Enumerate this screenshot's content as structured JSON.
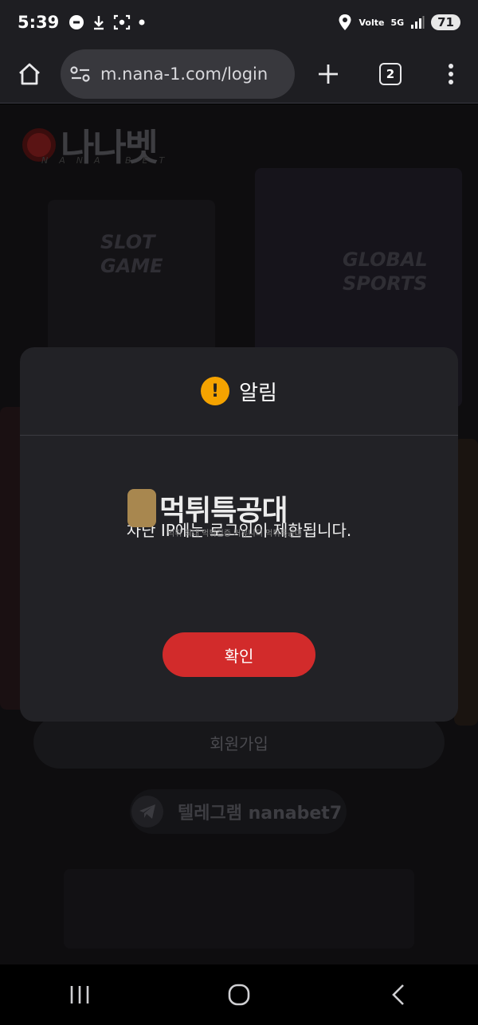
{
  "status_bar": {
    "time": "5:39",
    "network": "5G",
    "lte": "Volte",
    "battery": "71"
  },
  "browser": {
    "url": "m.nana-1.com/login",
    "tab_count": "2"
  },
  "page": {
    "logo_text": "나나벳",
    "logo_sub": "NANA BET",
    "bg_labels": [
      "SLOT GAME",
      "GLOBAL SPORTS"
    ],
    "join_button": "회원가입",
    "telegram_button": "텔레그램 nanabet7"
  },
  "modal": {
    "title": "알림",
    "message": "차단 IP에는 로그인이 제한됩니다.",
    "confirm_button": "확인"
  },
  "watermark": {
    "text": "먹튀특공대",
    "sub": "먹튀 최대 먹튀검증 커뮤니티 먹튀특공대"
  },
  "colors": {
    "accent_red": "#d22b2b",
    "warning": "#f5a300",
    "modal_bg": "#222226"
  }
}
